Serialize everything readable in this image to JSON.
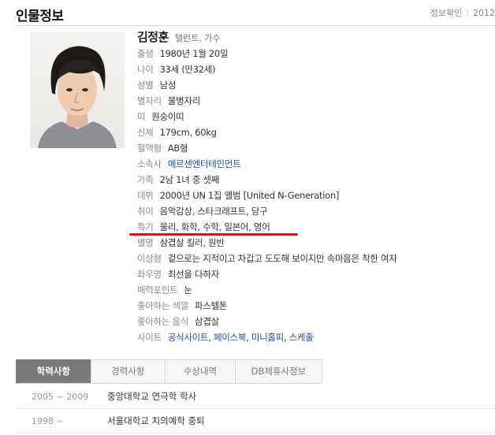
{
  "header": {
    "title": "인물정보",
    "verify_label": "정보확인",
    "date_prefix": "2012"
  },
  "profile": {
    "name": "김정훈",
    "occupation": "탤런트, 가수",
    "rows": [
      {
        "label": "출생",
        "value": "1980년 1월 20일"
      },
      {
        "label": "나이",
        "value": "33세 (만32세)"
      },
      {
        "label": "성별",
        "value": "남성"
      },
      {
        "label": "별자리",
        "value": "물병자리"
      },
      {
        "label": "띠",
        "value": "원숭이띠"
      },
      {
        "label": "신체",
        "value": "179cm, 60kg"
      },
      {
        "label": "혈액형",
        "value": "AB형"
      },
      {
        "label": "소속사",
        "value": "메르센엔터테인먼트"
      },
      {
        "label": "가족",
        "value": "2남 1녀 중 셋째"
      },
      {
        "label": "데뷔",
        "value": "2000년 UN 1집 앨범 [United N-Generation]"
      },
      {
        "label": "취미",
        "value": "음악감상, 스타크래프트, 당구"
      },
      {
        "label": "특기",
        "value": "물리, 화학, 수학, 일본어, 영어"
      },
      {
        "label": "별명",
        "value": "삼겹살 킬러, 원반"
      },
      {
        "label": "이상형",
        "value": "겉으로는 지적이고 차갑고 도도해 보이지만 속마음은 착한 여자"
      },
      {
        "label": "좌우명",
        "value": "최선을 다하자"
      },
      {
        "label": "매력포인트",
        "value": "눈"
      },
      {
        "label": "좋아하는 색깔",
        "value": "파스텔톤"
      },
      {
        "label": "좋아하는 음식",
        "value": "삼겹살"
      }
    ],
    "sites": {
      "label": "사이트",
      "links": [
        "공식사이트",
        "페이스북",
        "미니홈피",
        "스케줄"
      ],
      "separator": ","
    }
  },
  "tabs": [
    "학력사항",
    "경력사항",
    "수상내역",
    "DB제휴사정보"
  ],
  "active_tab": 0,
  "education": [
    {
      "period": "2005 ~ 2009",
      "school": "중앙대학교 연극학 학사"
    },
    {
      "period": "1998 ~",
      "school": "서울대학교 치의예학 중퇴"
    }
  ],
  "colors": {
    "accent_link": "#1a4f9c",
    "annotation_underline": "#e0101e",
    "active_tab_bg": "#7a7a7a"
  }
}
